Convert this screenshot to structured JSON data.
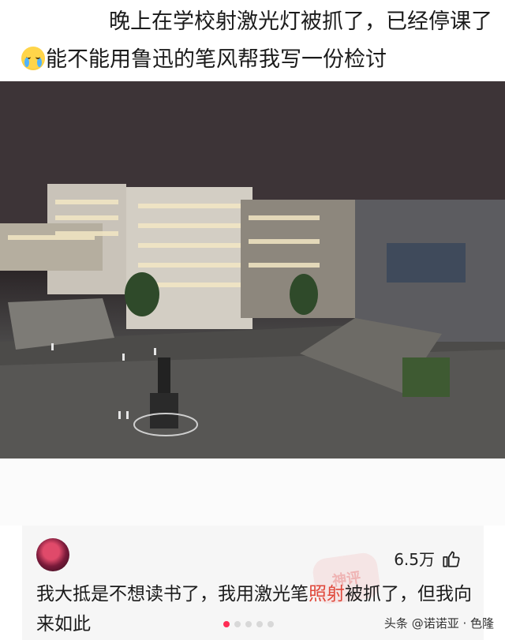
{
  "post": {
    "text_part1": "晚上在学校射激光灯被抓了，已经停课了",
    "emoji": "crying-face-emoji",
    "text_part2": "能不能用鲁迅的笔风帮我写一份检讨"
  },
  "photo": {
    "subject": "campus-night-photo"
  },
  "comment": {
    "likes": "6.5万",
    "text_before": "我大抵是不想读书了，我用激光笔",
    "text_highlight": "照射",
    "text_after": "被抓了，但我向来如此",
    "stamp": "神评"
  },
  "pagination": {
    "count": 5,
    "active_index": 0
  },
  "footer": {
    "watermark": "头条 @诺诺亚 · 色隆"
  },
  "colors": {
    "highlight": "#e0473a",
    "active_dot": "#ff2d55"
  }
}
